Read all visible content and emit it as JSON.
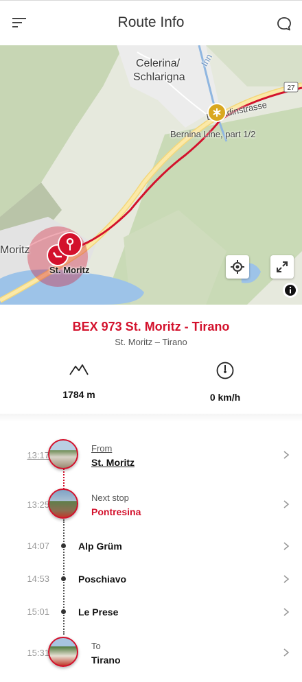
{
  "header": {
    "title": "Route Info",
    "menu_icon": "menu-icon",
    "chat_icon": "chat-icon"
  },
  "map": {
    "place_celerina": "Celerina/\nSchlarigna",
    "place_celerina_l1": "Celerina/",
    "place_celerina_l2": "Schlarigna",
    "place_moritz_left": "Moritz",
    "place_st_moritz": "St. Moritz",
    "poi_label": "Bernina Line, part 1/2",
    "river_label": "Inn",
    "street_label": "Engadinstrasse",
    "road_number": "27",
    "route_color": "#d3112c",
    "poi_color": "#d9a81f"
  },
  "route": {
    "title": "BEX 973 St. Moritz - Tirano",
    "subtitle": "St. Moritz – Tirano"
  },
  "stats": {
    "altitude": "1784 m",
    "speed": "0 km/h"
  },
  "stops": [
    {
      "time": "13:17",
      "label": "From",
      "name": "St. Moritz"
    },
    {
      "time": "13:25",
      "label": "Next stop",
      "name": "Pontresina"
    },
    {
      "time": "14:07",
      "name": "Alp Grüm"
    },
    {
      "time": "14:53",
      "name": "Poschiavo"
    },
    {
      "time": "15:01",
      "name": "Le Prese"
    },
    {
      "time": "15:31",
      "label": "To",
      "name": "Tirano"
    }
  ]
}
